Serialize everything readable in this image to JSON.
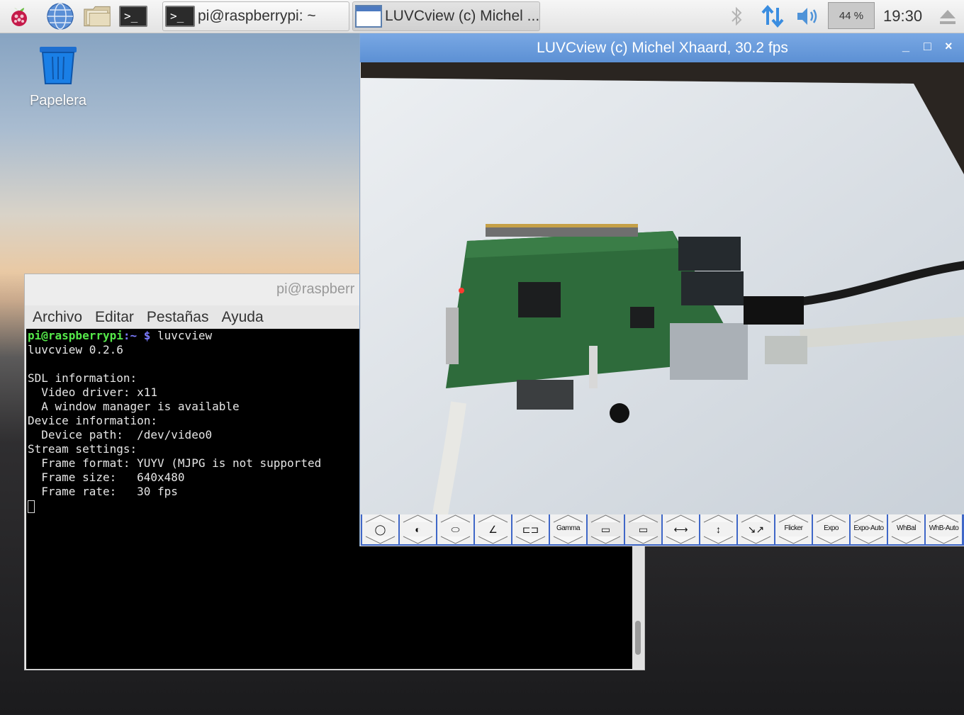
{
  "taskbar": {
    "launchers": [
      {
        "icon": "raspberry-menu-icon"
      },
      {
        "icon": "web-browser-icon"
      },
      {
        "icon": "file-manager-icon"
      },
      {
        "icon": "terminal-icon"
      }
    ],
    "tasks": [
      {
        "label": "pi@raspberrypi: ~",
        "icon": "terminal-icon",
        "active": false
      },
      {
        "label": "LUVCview (c) Michel ...",
        "icon": "window-icon",
        "active": true
      }
    ],
    "tray": {
      "bluetooth_icon": "bluetooth-icon",
      "network_icon": "network-icon",
      "volume_icon": "volume-icon",
      "cpu_usage": "44 %",
      "clock": "19:30",
      "eject_icon": "eject-icon"
    }
  },
  "desktop": {
    "trash_label": "Papelera"
  },
  "terminal": {
    "title": "pi@raspberr",
    "menu": [
      "Archivo",
      "Editar",
      "Pestañas",
      "Ayuda"
    ],
    "prompt_user": "pi@raspberrypi",
    "prompt_path": ":~ $",
    "command": " luvcview",
    "output": [
      "luvcview 0.2.6",
      "",
      "SDL information:",
      "  Video driver: x11",
      "  A window manager is available",
      "Device information:",
      "  Device path:  /dev/video0",
      "Stream settings:",
      "  Frame format: YUYV (MJPG is not supported",
      "  Frame size:   640x480",
      "  Frame rate:   30 fps"
    ]
  },
  "luvcview": {
    "title": "LUVCview (c) Michel Xhaard, 30.2 fps",
    "window_buttons": [
      "_",
      "□",
      "×"
    ],
    "controls": [
      {
        "name": "brightness",
        "label": "",
        "glyph": "◯"
      },
      {
        "name": "contrast",
        "label": "",
        "glyph": "◐"
      },
      {
        "name": "saturation",
        "label": "",
        "glyph": "⬭"
      },
      {
        "name": "sharpness",
        "label": "",
        "glyph": "∠"
      },
      {
        "name": "gain",
        "label": "",
        "glyph": "⊏⊐"
      },
      {
        "name": "gamma",
        "label": "Gamma",
        "glyph": ""
      },
      {
        "name": "record",
        "label": "",
        "glyph": "▭"
      },
      {
        "name": "snapshot",
        "label": "",
        "glyph": "▭"
      },
      {
        "name": "pan",
        "label": "",
        "glyph": "⟷"
      },
      {
        "name": "tilt",
        "label": "",
        "glyph": "↕"
      },
      {
        "name": "reset-pan-tilt",
        "label": "",
        "glyph": "↘↗"
      },
      {
        "name": "flicker",
        "label": "Flicker",
        "glyph": ""
      },
      {
        "name": "exposure",
        "label": "Expo",
        "glyph": ""
      },
      {
        "name": "exposure-auto",
        "label": "Expo-Auto",
        "glyph": ""
      },
      {
        "name": "white-balance",
        "label": "WhBal",
        "glyph": ""
      },
      {
        "name": "white-balance-auto",
        "label": "WhB-Auto",
        "glyph": ""
      }
    ]
  },
  "colors": {
    "title_bar": "#5c90d4",
    "control_bar": "#3f67c8",
    "prompt_user": "#55e94a",
    "prompt_path": "#7b7bff"
  }
}
